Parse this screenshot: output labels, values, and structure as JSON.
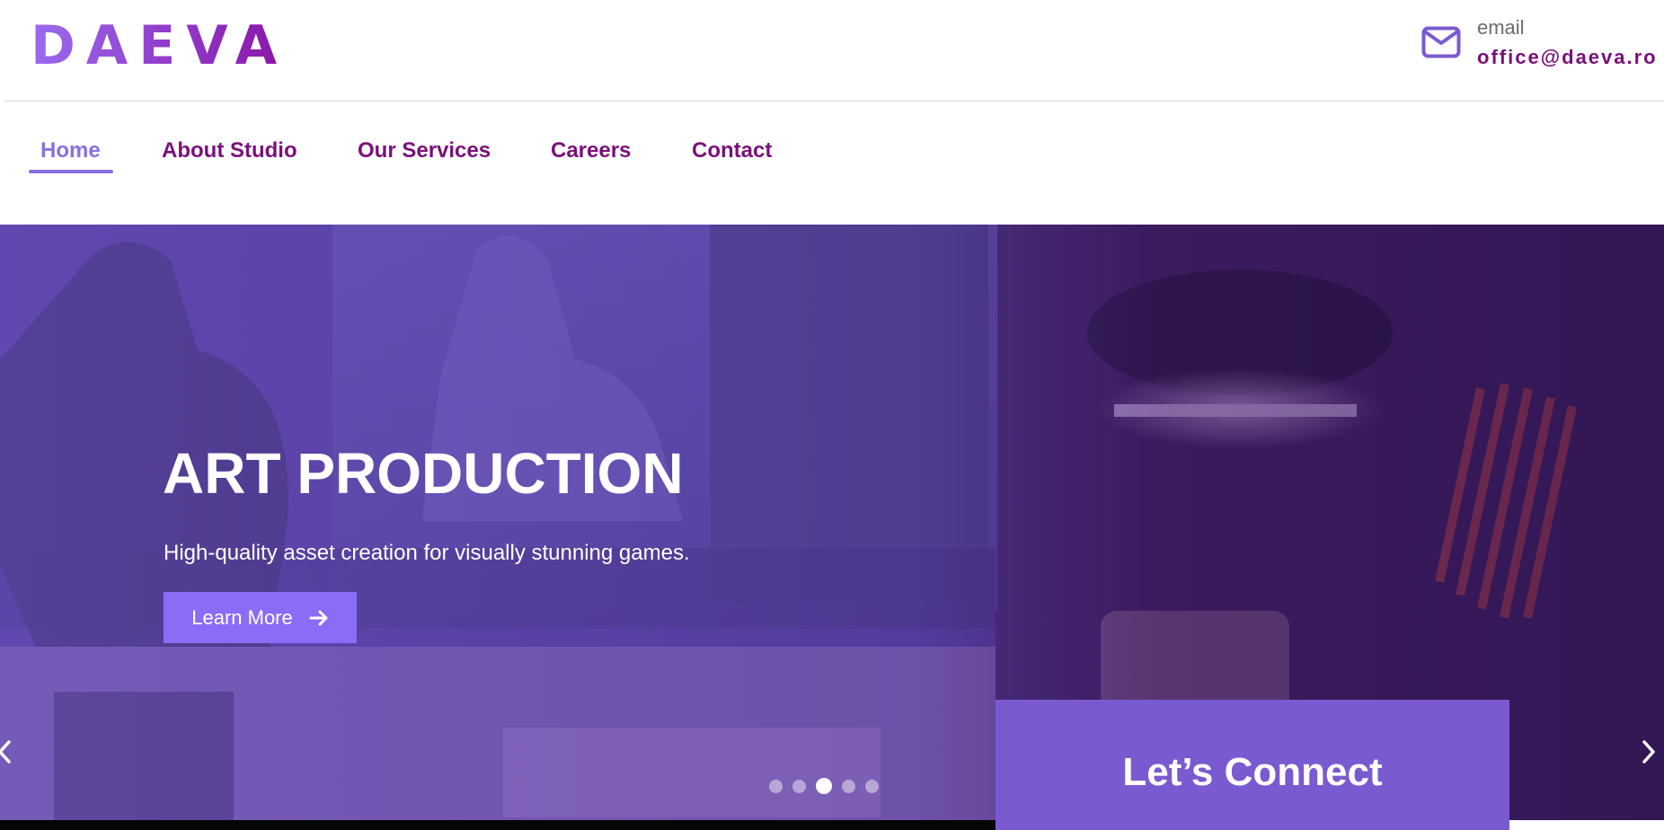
{
  "brand": {
    "logo_text": "DAEVA",
    "colors": {
      "primary": "#7a107a",
      "accent": "#8b6fe0",
      "button": "#8a6cf7",
      "connect": "#7a5ad0"
    }
  },
  "header": {
    "email_label": "email",
    "email_value": "office@daeva.ro",
    "icon": "mail-icon"
  },
  "nav": {
    "items": [
      {
        "label": "Home",
        "active": true
      },
      {
        "label": "About Studio"
      },
      {
        "label": "Our Services"
      },
      {
        "label": "Careers"
      },
      {
        "label": "Contact"
      }
    ]
  },
  "hero": {
    "title": "ART PRODUCTION",
    "subtitle": "High-quality asset creation for visually stunning games.",
    "button_label": "Learn More",
    "slides_total": 5,
    "active_slide": 3
  },
  "connect": {
    "title": "Let’s Connect"
  }
}
